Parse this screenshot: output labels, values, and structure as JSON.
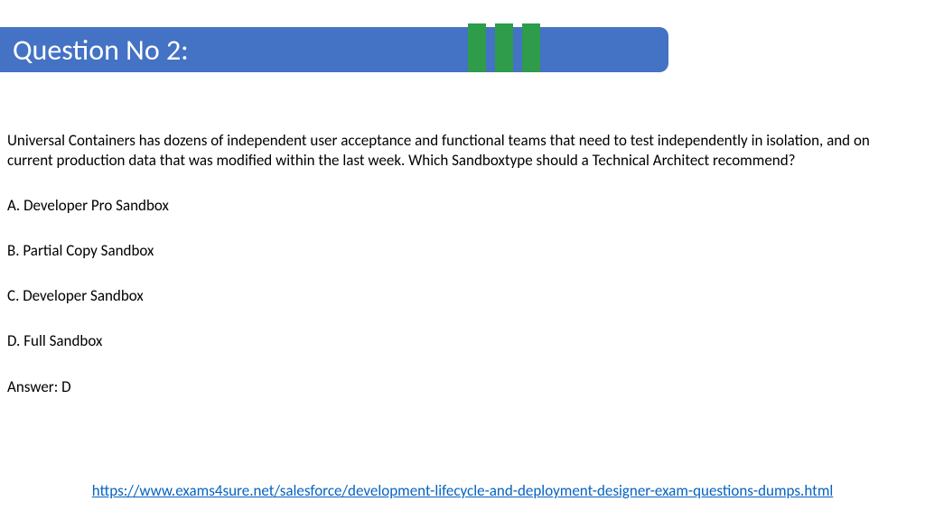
{
  "title": "Question No 2:",
  "question": "Universal Containers has dozens of independent user acceptance and functional teams that need to test independently in isolation, and on current production data that was modified within the last week. Which Sandboxtype should a Technical Architect recommend?",
  "options": {
    "a": "A. Developer Pro Sandbox",
    "b": "B. Partial Copy Sandbox",
    "c": "C. Developer Sandbox",
    "d": "D. Full Sandbox"
  },
  "answer": "Answer: D",
  "link": "https://www.exams4sure.net/salesforce/development-lifecycle-and-deployment-designer-exam-questions-dumps.html"
}
